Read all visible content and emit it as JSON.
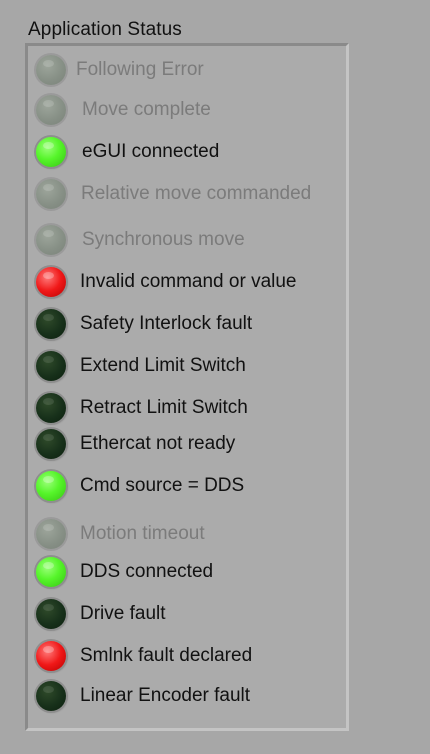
{
  "title": "Application Status",
  "indicators": [
    {
      "label": "Following Error",
      "state": "disabled",
      "color": "#879086"
    },
    {
      "label": "Move complete",
      "state": "disabled",
      "color": "#879086"
    },
    {
      "label": "eGUI connected",
      "state": "on",
      "color": "#56f52a"
    },
    {
      "label": "Relative move commanded",
      "state": "disabled",
      "color": "#879086"
    },
    {
      "label": "Synchronous move",
      "state": "disabled",
      "color": "#879086"
    },
    {
      "label": "Invalid command or value",
      "state": "alarm",
      "color": "#f01818"
    },
    {
      "label": "Safety Interlock fault",
      "state": "off",
      "color": "#17301a"
    },
    {
      "label": "Extend Limit Switch",
      "state": "off",
      "color": "#17301a"
    },
    {
      "label": "Retract Limit Switch",
      "state": "off",
      "color": "#17301a"
    },
    {
      "label": "Ethercat not ready",
      "state": "off",
      "color": "#17301a"
    },
    {
      "label": "Cmd source = DDS",
      "state": "on",
      "color": "#56f52a"
    },
    {
      "label": "Motion timeout",
      "state": "disabled",
      "color": "#879086"
    },
    {
      "label": "DDS connected",
      "state": "on",
      "color": "#56f52a"
    },
    {
      "label": "Drive fault",
      "state": "off",
      "color": "#17301a"
    },
    {
      "label": "Smlnk fault declared",
      "state": "alarm",
      "color": "#f01818"
    },
    {
      "label": "Linear Encoder fault",
      "state": "off",
      "color": "#17301a"
    }
  ]
}
